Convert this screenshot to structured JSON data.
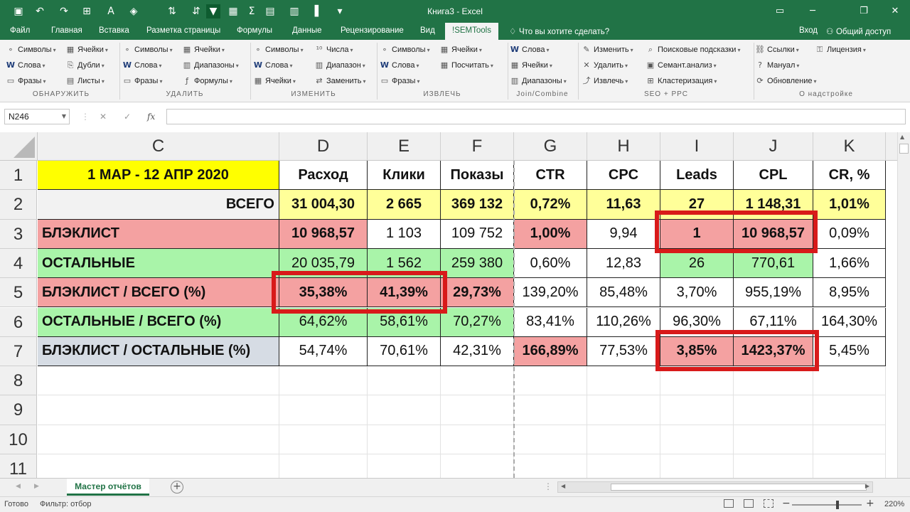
{
  "app": {
    "title": "Книга3 - Excel",
    "quick_access_icons": [
      "save-icon",
      "undo-icon",
      "redo-icon",
      "borders-icon",
      "font-color-icon",
      "fill-color-icon",
      "sort-asc-icon",
      "sort-desc-icon",
      "filter-icon",
      "format-icon",
      "sum-icon",
      "table-icon",
      "grid-icon",
      "column-icon",
      "more-icon"
    ]
  },
  "ribbon_tabs": [
    "Файл",
    "Главная",
    "Вставка",
    "Разметка страницы",
    "Формулы",
    "Данные",
    "Рецензирование",
    "Вид",
    "!SEMTools",
    "Что вы хотите сделать?"
  ],
  "ribbon_right": {
    "login": "Вход",
    "share": "Общий доступ"
  },
  "ribbon_groups": [
    {
      "name": "ОБНАРУЖИТЬ",
      "items": [
        "Символы",
        "Ячейки",
        "Слова",
        "Дубли",
        "Фразы",
        "Листы"
      ]
    },
    {
      "name": "УДАЛИТЬ",
      "items": [
        "Символы",
        "Ячейки",
        "Слова",
        "Диапазоны",
        "Фразы",
        "Формулы"
      ]
    },
    {
      "name": "ИЗМЕНИТЬ",
      "items": [
        "Символы",
        "Числа",
        "Слова",
        "Диапазон",
        "Ячейки",
        "Заменить"
      ]
    },
    {
      "name": "ИЗВЛЕЧЬ",
      "items": [
        "Символы",
        "Ячейки",
        "Слова",
        "Посчитать",
        "Фразы"
      ]
    },
    {
      "name": "Join/Combine",
      "items": [
        "Слова",
        "Ячейки",
        "Диапазоны"
      ]
    },
    {
      "name": "SEO + PPC",
      "items": [
        "Изменить",
        "Поисковые подсказки",
        "Удалить",
        "Семант.анализ",
        "Извлечь",
        "Кластеризация"
      ]
    },
    {
      "name": "О надстройке",
      "items": [
        "Ссылки",
        "Лицензия",
        "Мануал",
        "Обновление"
      ]
    }
  ],
  "formula_bar": {
    "name_box": "N246",
    "cancel": "✕",
    "confirm": "✓",
    "fx": "fx",
    "formula": ""
  },
  "columns": [
    "C",
    "D",
    "E",
    "F",
    "G",
    "H",
    "I",
    "J",
    "K"
  ],
  "rows": [
    "1",
    "2",
    "3",
    "4",
    "5",
    "6",
    "7",
    "8",
    "9",
    "10",
    "11"
  ],
  "cells": [
    [
      "1 МАР - 12 АПР 2020",
      "Расход",
      "Клики",
      "Показы",
      "CTR",
      "CPC",
      "Leads",
      "CPL",
      "CR, %"
    ],
    [
      "ВСЕГО",
      "31 004,30",
      "2 665",
      "369 132",
      "0,72%",
      "11,63",
      "27",
      "1 148,31",
      "1,01%"
    ],
    [
      "БЛЭКЛИСТ",
      "10 968,57",
      "1 103",
      "109 752",
      "1,00%",
      "9,94",
      "1",
      "10 968,57",
      "0,09%"
    ],
    [
      "ОСТАЛЬНЫЕ",
      "20 035,79",
      "1 562",
      "259 380",
      "0,60%",
      "12,83",
      "26",
      "770,61",
      "1,66%"
    ],
    [
      "БЛЭКЛИСТ / ВСЕГО (%)",
      "35,38%",
      "41,39%",
      "29,73%",
      "139,20%",
      "85,48%",
      "3,70%",
      "955,19%",
      "8,95%"
    ],
    [
      "ОСТАЛЬНЫЕ / ВСЕГО (%)",
      "64,62%",
      "58,61%",
      "70,27%",
      "83,41%",
      "110,26%",
      "96,30%",
      "67,11%",
      "164,30%"
    ],
    [
      "БЛЭКЛИСТ / ОСТАЛЬНЫЕ (%)",
      "54,74%",
      "70,61%",
      "42,31%",
      "166,89%",
      "77,53%",
      "3,85%",
      "1423,37%",
      "5,45%"
    ]
  ],
  "colors": {
    "excel_green": "#217346",
    "yellow_title": "#ffff00",
    "yellow_total": "#ffff99",
    "red_fill": "#f4a1a1",
    "green_fill": "#a9f4a9",
    "blue_gray": "#d6dce4",
    "highlight_border": "#d81a1a"
  },
  "sheet": {
    "tab": "Мастер отчётов",
    "add": "+"
  },
  "status": {
    "ready": "Готово",
    "filter": "Фильтр: отбор",
    "zoom": "220%"
  }
}
